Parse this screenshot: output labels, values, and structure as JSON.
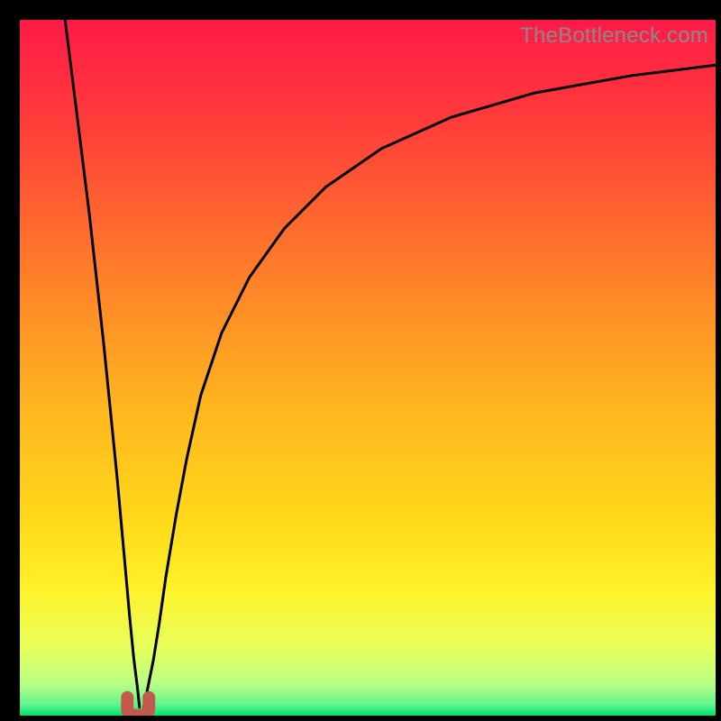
{
  "watermark": "TheBottleneck.com",
  "chart_data": {
    "type": "line",
    "title": "",
    "xlabel": "",
    "ylabel": "",
    "xlim": [
      0,
      100
    ],
    "ylim": [
      0,
      100
    ],
    "grid": false,
    "legend": false,
    "background": {
      "description": "Vertical gradient from red (top) through orange-yellow to a thin light-green strip, with a pure green baseline at the bottom.",
      "stops": [
        {
          "pos": 0.0,
          "color": "#ff1a48"
        },
        {
          "pos": 0.15,
          "color": "#ff3d3a"
        },
        {
          "pos": 0.35,
          "color": "#ff7a2a"
        },
        {
          "pos": 0.55,
          "color": "#ffb41f"
        },
        {
          "pos": 0.72,
          "color": "#ffd91a"
        },
        {
          "pos": 0.82,
          "color": "#fff22a"
        },
        {
          "pos": 0.9,
          "color": "#e8ff5a"
        },
        {
          "pos": 0.955,
          "color": "#b8ff84"
        },
        {
          "pos": 0.985,
          "color": "#5cf48c"
        },
        {
          "pos": 1.0,
          "color": "#00e26a"
        }
      ]
    },
    "marker": {
      "shape": "u",
      "color": "#c45a4e",
      "x": 17,
      "y": 0.8
    },
    "series": [
      {
        "name": "left-branch",
        "stroke": "#000000",
        "x": [
          6.5,
          8,
          9,
          10,
          11,
          12,
          13,
          14,
          15,
          15.8,
          16.4,
          16.9,
          17.2
        ],
        "y": [
          100,
          88,
          80,
          72,
          63,
          54,
          44,
          34,
          23,
          14,
          8,
          4,
          1.2
        ]
      },
      {
        "name": "right-branch",
        "stroke": "#000000",
        "x": [
          17.8,
          18.4,
          19.2,
          20,
          21,
          22.5,
          24,
          26,
          29,
          33,
          38,
          44,
          52,
          62,
          74,
          88,
          100
        ],
        "y": [
          1.2,
          4,
          8,
          13,
          20,
          29,
          37,
          46,
          55,
          63,
          70,
          76,
          81.5,
          86,
          89.5,
          92,
          93.5
        ]
      }
    ]
  }
}
